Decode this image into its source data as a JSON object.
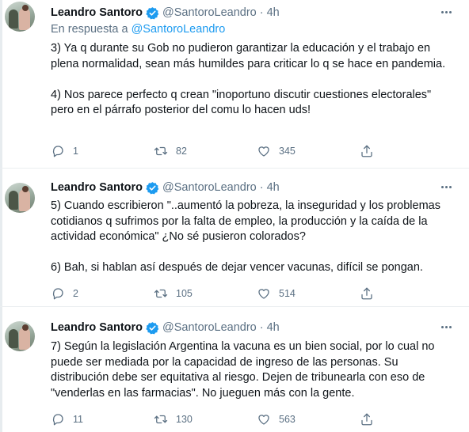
{
  "tweets": [
    {
      "author_name": "Leandro Santoro",
      "handle": "@SantoroLeandro",
      "separator": "·",
      "time": "4h",
      "reply_prefix": "En respuesta a",
      "reply_to": "@SantoroLeandro",
      "text": "3) Ya q durante su Gob no pudieron garantizar la educación y el trabajo en plena normalidad, sean más humildes para criticar lo q se hace en pandemia.\n\n4) Nos parece perfecto q crean \"inoportuno discutir cuestiones electorales\" pero en el párrafo posterior del comu lo hacen uds!",
      "replies": "1",
      "retweets": "82",
      "likes": "345"
    },
    {
      "author_name": "Leandro Santoro",
      "handle": "@SantoroLeandro",
      "separator": "·",
      "time": "4h",
      "text": "5) Cuando escribieron \"..aumentó la pobreza, la inseguridad y los problemas cotidianos q sufrimos por la falta de empleo, la producción y la caída de la actividad económica\" ¿No sé pusieron colorados?\n\n6) Bah, si hablan así después de dejar vencer vacunas, difícil se pongan.",
      "replies": "2",
      "retweets": "105",
      "likes": "514"
    },
    {
      "author_name": "Leandro Santoro",
      "handle": "@SantoroLeandro",
      "separator": "·",
      "time": "4h",
      "text": "7) Según la legislación Argentina la vacuna es un bien social, por lo cual no puede ser mediada por la capacidad de ingreso de las personas. Su distribución debe ser equitativa al riesgo. Dejen de tribunearla con eso de \"venderlas en las farmacias\". No jueguen más con la gente.",
      "replies": "11",
      "retweets": "130",
      "likes": "563"
    }
  ],
  "colors": {
    "text": "#0f1419",
    "secondary": "#5b7083",
    "link": "#1d9bf0",
    "verified": "#1d9bf0",
    "divider": "#ebeef0"
  },
  "icons": {
    "verified": "verified-badge-icon",
    "more": "more-options-icon",
    "reply": "reply-icon",
    "retweet": "retweet-icon",
    "like": "like-icon",
    "share": "share-icon"
  }
}
